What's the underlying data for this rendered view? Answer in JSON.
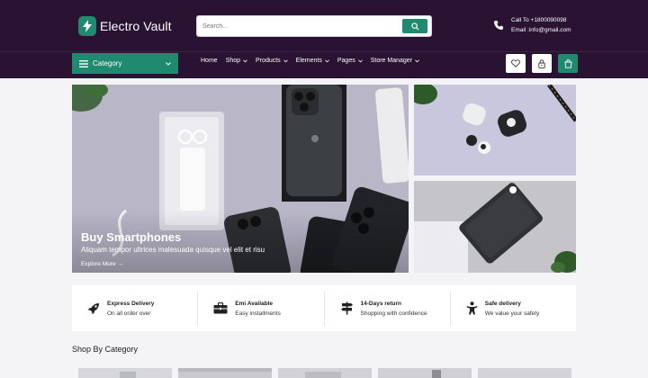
{
  "header": {
    "logo_text": "Electro Vault",
    "search_placeholder": "Search...",
    "contact_phone": "Call To +1800090098",
    "contact_email": "Email :info@gmail.com"
  },
  "nav": {
    "category_label": "Category",
    "links": [
      {
        "label": "Home",
        "has_dropdown": false
      },
      {
        "label": "Shop",
        "has_dropdown": true
      },
      {
        "label": "Products",
        "has_dropdown": true
      },
      {
        "label": "Elements",
        "has_dropdown": true
      },
      {
        "label": "Pages",
        "has_dropdown": true
      },
      {
        "label": "Store Manager",
        "has_dropdown": true
      }
    ],
    "icons": [
      "heart-icon",
      "lock-icon",
      "cart-icon"
    ]
  },
  "hero": {
    "title": "Buy Smartphones",
    "subtitle": "Aliquam tempor ultrices malesuada quisque vel elit et risu",
    "link": "Explore More →"
  },
  "features": [
    {
      "icon": "rocket-icon",
      "title": "Express Delivery",
      "desc": "On all order over"
    },
    {
      "icon": "briefcase-icon",
      "title": "Emi Available",
      "desc": "Easy installments"
    },
    {
      "icon": "signpost-icon",
      "title": "14-Days return",
      "desc": "Shopping with confidence"
    },
    {
      "icon": "person-icon",
      "title": "Safe delivery",
      "desc": "We value your safety"
    }
  ],
  "shop_by_category": {
    "title": "Shop By Category"
  },
  "colors": {
    "header_bg": "#2a1233",
    "accent": "#1f8a70",
    "page_bg": "#f4f4f6"
  }
}
